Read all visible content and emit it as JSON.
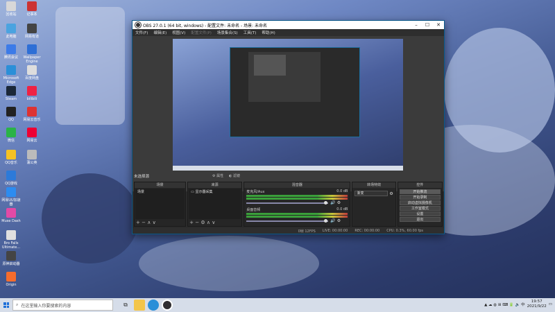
{
  "desktop": {
    "icons": [
      {
        "label": "回收站",
        "color": "#d8d8d8"
      },
      {
        "label": "此电脑",
        "color": "#4aa3e0"
      },
      {
        "label": "腾讯会议",
        "color": "#3c7be8"
      },
      {
        "label": "Microsoft Edge",
        "color": "#2b8fd8"
      },
      {
        "label": "Steam",
        "color": "#1b2838"
      },
      {
        "label": "QQ",
        "color": "#222"
      },
      {
        "label": "微信",
        "color": "#2ab347"
      },
      {
        "label": "QQ音乐",
        "color": "#f6c224"
      },
      {
        "label": "QQ游戏",
        "color": "#2d7ad9"
      },
      {
        "label": "网易UU加速器",
        "color": "#2d8cf0"
      },
      {
        "label": "Muse Dash",
        "color": "#e24aa6"
      },
      {
        "label": "Bro Falls Ultimate...",
        "color": "#e0e0e0"
      },
      {
        "label": "原神启动器",
        "color": "#444"
      },
      {
        "label": "Origin",
        "color": "#f56c2d"
      }
    ],
    "icons_col2": [
      {
        "label": "记事本",
        "color": "#c33"
      },
      {
        "label": "网易有道",
        "color": "#444"
      },
      {
        "label": "Wallpaper Engine",
        "color": "#2e6fd6"
      },
      {
        "label": "百度网盘",
        "color": "#ddd"
      },
      {
        "label": "bilibili",
        "color": "#e24"
      },
      {
        "label": "网易云音乐",
        "color": "#d33"
      },
      {
        "label": "网易云",
        "color": "#e03"
      },
      {
        "label": "蒲公英",
        "color": "#bbb"
      }
    ]
  },
  "obs": {
    "title": "OBS 27.0.1 (64 bit, windows) - 配置文件: 未命名 - 场景: 未命名",
    "menu": [
      "文件(F)",
      "编辑(E)",
      "视图(V)",
      "配置文件(P)",
      "场景集合(S)",
      "工具(T)",
      "帮助(H)"
    ],
    "no_source": "未选择源",
    "props_btn": "属性",
    "filters_btn": "滤镜",
    "docks": {
      "scenes": {
        "title": "场景",
        "items": [
          "场景"
        ]
      },
      "sources": {
        "title": "来源",
        "items": [
          "显示器采集"
        ]
      },
      "mixer": {
        "title": "混音器",
        "channels": [
          {
            "name": "麦克风/Aux",
            "db": "0.0 dB",
            "level": 0.8
          },
          {
            "name": "桌面音频",
            "db": "0.0 dB",
            "level": 0.8
          }
        ]
      },
      "transitions": {
        "title": "转场特效",
        "value": "渐变"
      },
      "controls": {
        "title": "控件",
        "buttons": [
          "开始推流",
          "开始录制",
          "启动虚拟摄像机",
          "工作室模式",
          "设置",
          "退出"
        ]
      }
    },
    "status": {
      "dropped": "0帧 12FPS",
      "live": "LIVE: 00:00:00",
      "rec": "REC: 00:00:00",
      "cpu": "CPU: 0.3%, 60.00 fps"
    }
  },
  "taskbar": {
    "search_placeholder": "在这里输入你要搜索的内容",
    "time": "19:57",
    "date": "2021/9/22"
  }
}
